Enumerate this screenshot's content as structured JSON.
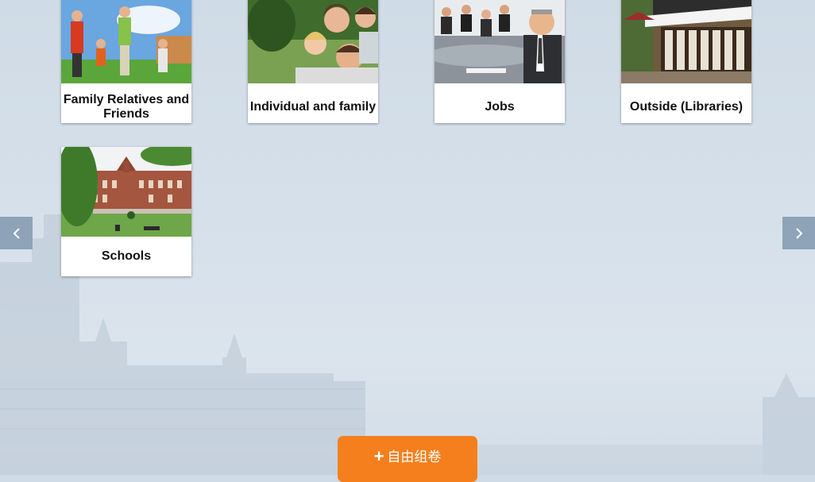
{
  "cards": [
    {
      "label": "Family Relatives and Friends",
      "image": "family-outdoors-photo"
    },
    {
      "label": "Individual and family",
      "image": "family-portrait-photo"
    },
    {
      "label": "Jobs",
      "image": "business-meeting-photo"
    },
    {
      "label": "Outside (Libraries)",
      "image": "street-cafe-photo"
    },
    {
      "label": "Schools",
      "image": "school-building-photo"
    }
  ],
  "nav": {
    "prev_label": "<",
    "next_label": ">"
  },
  "compose_button": {
    "icon": "plus-icon",
    "label": "自由组卷"
  },
  "colors": {
    "accent": "#f57f1d",
    "nav_arrow": "#8ea3b7",
    "background": "#d6e0ea"
  }
}
